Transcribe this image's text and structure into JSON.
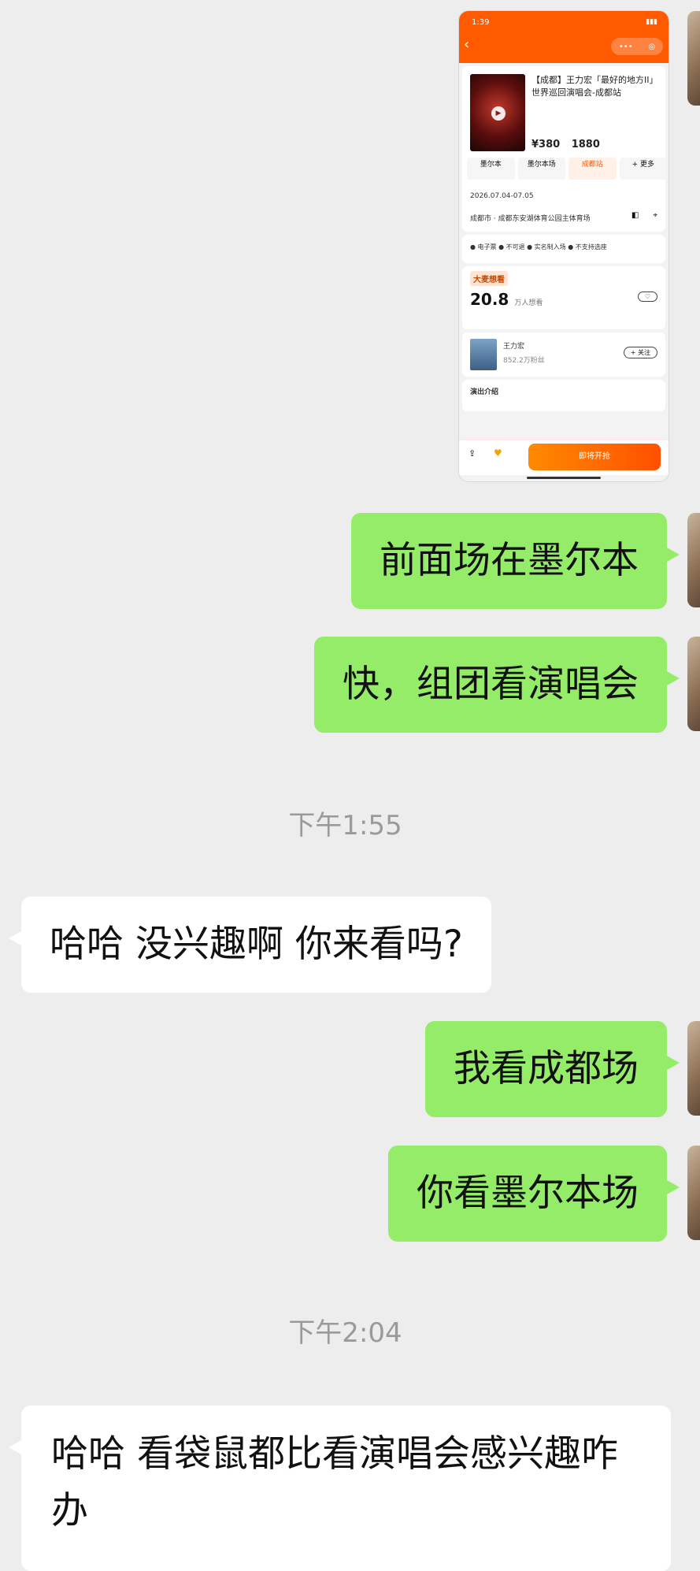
{
  "shared_screenshot": {
    "status_time": "1:39",
    "event_title": "【成都】王力宏「最好的地方II」世界巡回演唱会-成都站",
    "prices": [
      "¥380",
      "1880"
    ],
    "sessions": [
      "墨尔本",
      "墨尔本场",
      "成都站",
      "+ 更多"
    ],
    "date": "2026.07.04-07.05",
    "venue": "成都市 · 成都东安湖体育公园主体育场",
    "tags": "● 电子票 ● 不可退 ● 实名制入场 ● 不支持选座",
    "hot_label": "大麦想看",
    "want_count": "20.8",
    "want_unit": "万人想看",
    "artist_name": "王力宏",
    "artist_fans": "852.2万粉丝",
    "follow_label": "+ 关注",
    "intro_label": "演出介绍",
    "cta_label": "即将开抢"
  },
  "messages": [
    {
      "side": "me",
      "text": "前面场在墨尔本"
    },
    {
      "side": "me",
      "text": "快，组团看演唱会"
    },
    {
      "side": "time",
      "text": "下午1:55"
    },
    {
      "side": "other",
      "text": "哈哈 没兴趣啊 你来看吗?"
    },
    {
      "side": "me",
      "text": "我看成都场"
    },
    {
      "side": "me",
      "text": "你看墨尔本场"
    },
    {
      "side": "time",
      "text": "下午2:04"
    },
    {
      "side": "other",
      "text": "哈哈 看袋鼠都比看演唱会感兴趣咋办"
    }
  ],
  "colors": {
    "background": "#ededed",
    "my_bubble": "#95ec69",
    "their_bubble": "#ffffff",
    "app_brand": "#ff5a00"
  }
}
